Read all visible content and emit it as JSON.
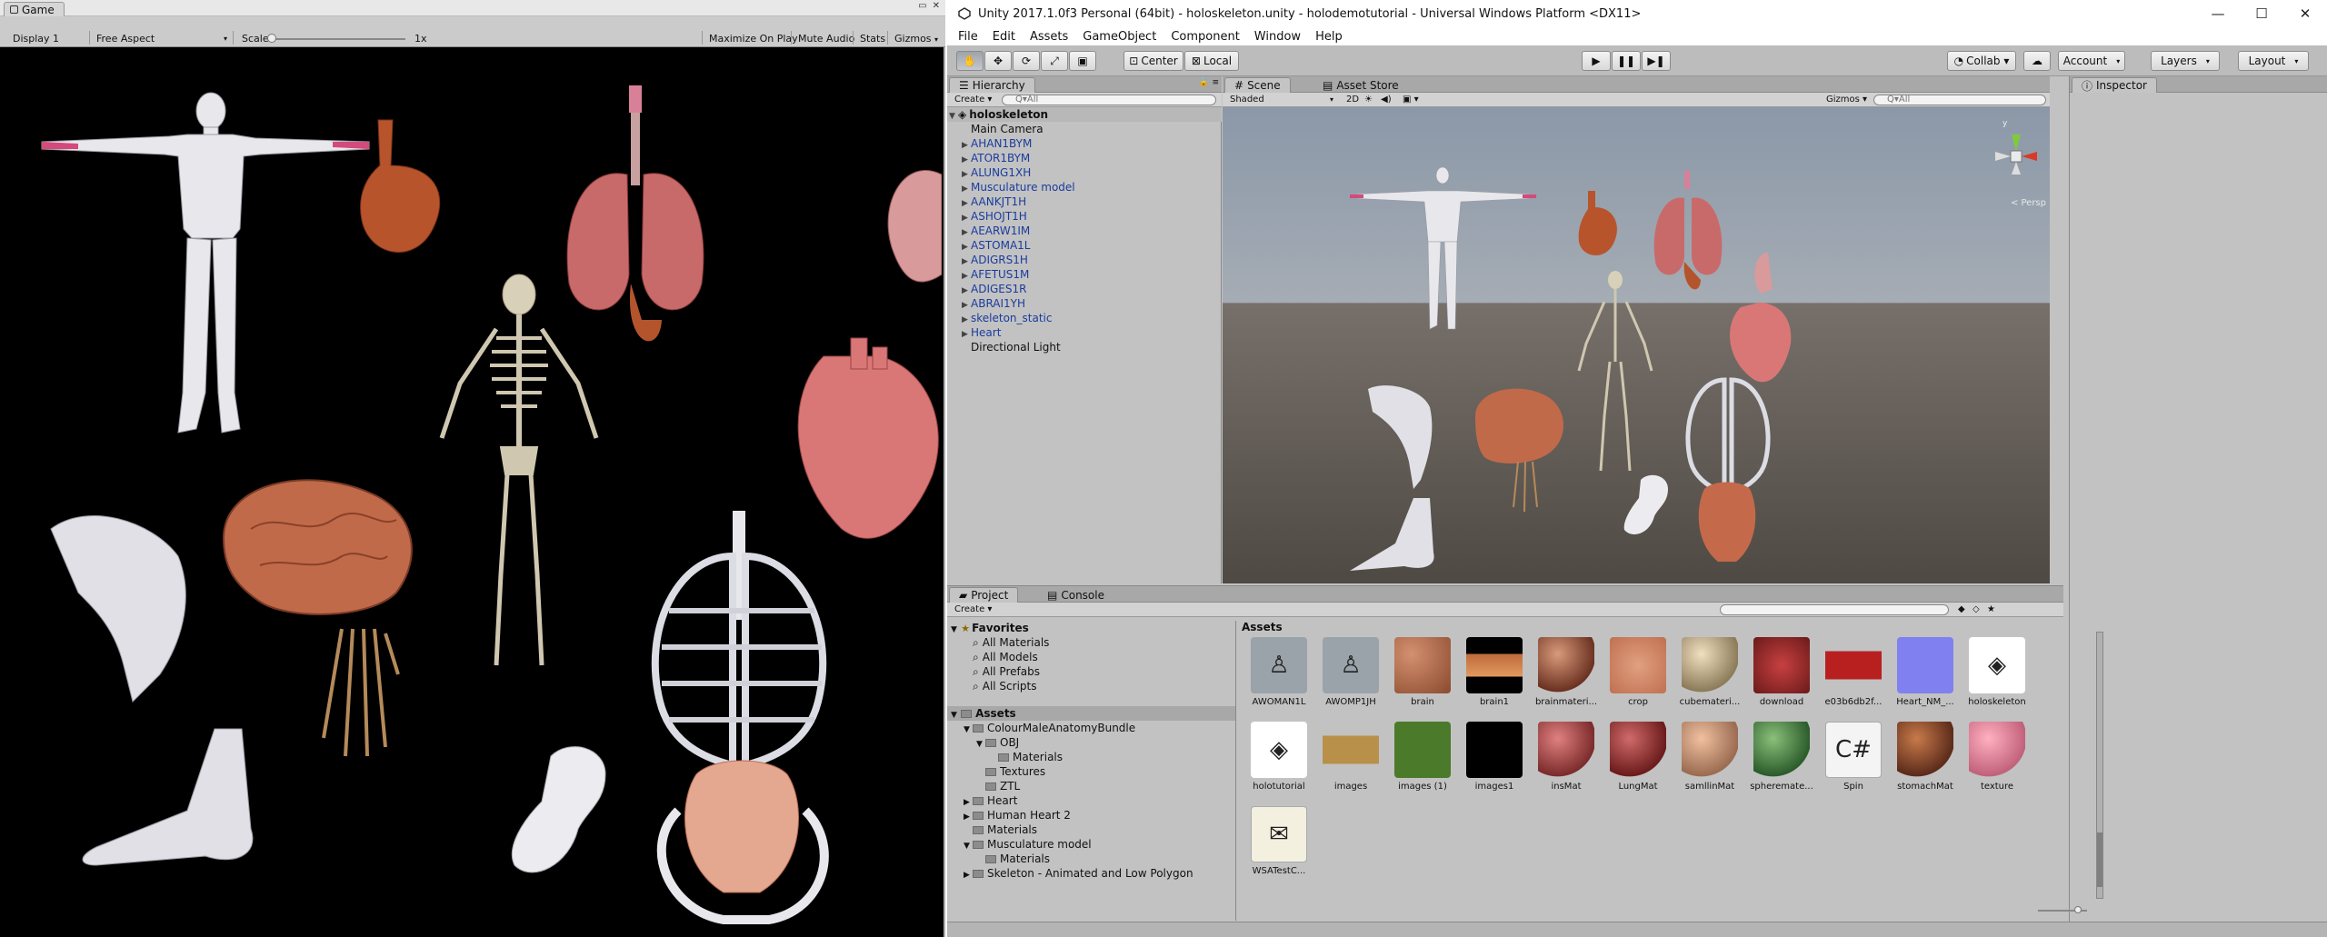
{
  "game": {
    "tab_label": "Game",
    "display": "Display 1",
    "aspect": "Free Aspect",
    "scale_label": "Scale",
    "scale_value": "1x",
    "maximize_on_play": "Maximize On Play",
    "mute_audio": "Mute Audio",
    "stats": "Stats",
    "gizmos": "Gizmos"
  },
  "window": {
    "title": "Unity 2017.1.0f3 Personal (64bit) - holoskeleton.unity - holodemotutorial - Universal Windows Platform <DX11>",
    "minimize": "—",
    "maximize": "☐",
    "close": "✕"
  },
  "menu": [
    "File",
    "Edit",
    "Assets",
    "GameObject",
    "Component",
    "Window",
    "Help"
  ],
  "toolbar": {
    "center": "Center",
    "local": "Local",
    "collab": "Collab ▾",
    "account": "Account",
    "layers": "Layers",
    "layout": "Layout"
  },
  "hierarchy": {
    "tab": "Hierarchy",
    "create": "Create ▾",
    "search_placeholder": "Q▾All",
    "scene_name": "holoskeleton",
    "items": [
      {
        "label": "Main Camera",
        "expand": false,
        "blue": false
      },
      {
        "label": "AHAN1BYM",
        "expand": true,
        "blue": true
      },
      {
        "label": "ATOR1BYM",
        "expand": true,
        "blue": true
      },
      {
        "label": "ALUNG1XH",
        "expand": true,
        "blue": true
      },
      {
        "label": "Musculature model",
        "expand": true,
        "blue": true
      },
      {
        "label": "AANKJT1H",
        "expand": true,
        "blue": true
      },
      {
        "label": "ASHOJT1H",
        "expand": true,
        "blue": true
      },
      {
        "label": "AEARW1IM",
        "expand": true,
        "blue": true
      },
      {
        "label": "ASTOMA1L",
        "expand": true,
        "blue": true
      },
      {
        "label": "ADIGRS1H",
        "expand": true,
        "blue": true
      },
      {
        "label": "AFETUS1M",
        "expand": true,
        "blue": true
      },
      {
        "label": "ADIGES1R",
        "expand": true,
        "blue": true
      },
      {
        "label": "ABRAI1YH",
        "expand": true,
        "blue": true
      },
      {
        "label": "skeleton_static",
        "expand": true,
        "blue": true
      },
      {
        "label": "Heart",
        "expand": true,
        "blue": true
      },
      {
        "label": "Directional Light",
        "expand": false,
        "blue": false
      }
    ]
  },
  "scene": {
    "tab": "Scene",
    "asset_store_tab": "Asset Store",
    "shading": "Shaded",
    "mode_2d": "2D",
    "gizmos": "Gizmos ▾",
    "search_placeholder": "Q▾All",
    "persp": "< Persp"
  },
  "inspector": {
    "tab": "Inspector"
  },
  "project": {
    "tab": "Project",
    "console_tab": "Console",
    "create": "Create ▾",
    "breadcrumb": "Assets",
    "favorites_label": "Favorites",
    "favorites": [
      "All Materials",
      "All Models",
      "All Prefabs",
      "All Scripts"
    ],
    "assets_label": "Assets",
    "tree": [
      {
        "label": "ColourMaleAnatomyBundle",
        "indent": 1,
        "arrow": "▼"
      },
      {
        "label": "OBJ",
        "indent": 2,
        "arrow": "▼"
      },
      {
        "label": "Materials",
        "indent": 3,
        "arrow": ""
      },
      {
        "label": "Textures",
        "indent": 2,
        "arrow": ""
      },
      {
        "label": "ZTL",
        "indent": 2,
        "arrow": ""
      },
      {
        "label": "Heart",
        "indent": 1,
        "arrow": "▶"
      },
      {
        "label": "Human Heart 2",
        "indent": 1,
        "arrow": "▶"
      },
      {
        "label": "Materials",
        "indent": 1,
        "arrow": ""
      },
      {
        "label": "Musculature model",
        "indent": 1,
        "arrow": "▼"
      },
      {
        "label": "Materials",
        "indent": 2,
        "arrow": ""
      },
      {
        "label": "Skeleton - Animated and Low Polygon",
        "indent": 1,
        "arrow": "▶"
      }
    ],
    "assets_row1": [
      {
        "label": "AWOMAN1L",
        "kind": "model"
      },
      {
        "label": "AWOMP1JH",
        "kind": "model"
      },
      {
        "label": "brain",
        "kind": "brain-tex"
      },
      {
        "label": "brain1",
        "kind": "brain1-tex"
      },
      {
        "label": "brainmateri...",
        "kind": "sphere-brown"
      },
      {
        "label": "crop",
        "kind": "crop-tex"
      },
      {
        "label": "cubemateri...",
        "kind": "sphere-beige"
      },
      {
        "label": "download",
        "kind": "download-tex"
      },
      {
        "label": "e03b6db2f...",
        "kind": "red-tex"
      },
      {
        "label": "Heart_NM_...",
        "kind": "normal-tex"
      },
      {
        "label": "holoskeleton",
        "kind": "unity-scene"
      }
    ],
    "assets_row2": [
      {
        "label": "holotutorial",
        "kind": "unity-scene"
      },
      {
        "label": "images",
        "kind": "tan-tex"
      },
      {
        "label": "images (1)",
        "kind": "green-tex"
      },
      {
        "label": "images1",
        "kind": "black-tex"
      },
      {
        "label": "insMat",
        "kind": "sphere-red"
      },
      {
        "label": "LungMat",
        "kind": "sphere-darkred"
      },
      {
        "label": "samllinMat",
        "kind": "sphere-skin"
      },
      {
        "label": "spheremate...",
        "kind": "sphere-green"
      },
      {
        "label": "Spin",
        "kind": "script"
      },
      {
        "label": "stomachMat",
        "kind": "sphere-brown2"
      },
      {
        "label": "texture",
        "kind": "sphere-pink"
      }
    ],
    "assets_row3": [
      {
        "label": "WSATestC...",
        "kind": "cert"
      }
    ]
  }
}
